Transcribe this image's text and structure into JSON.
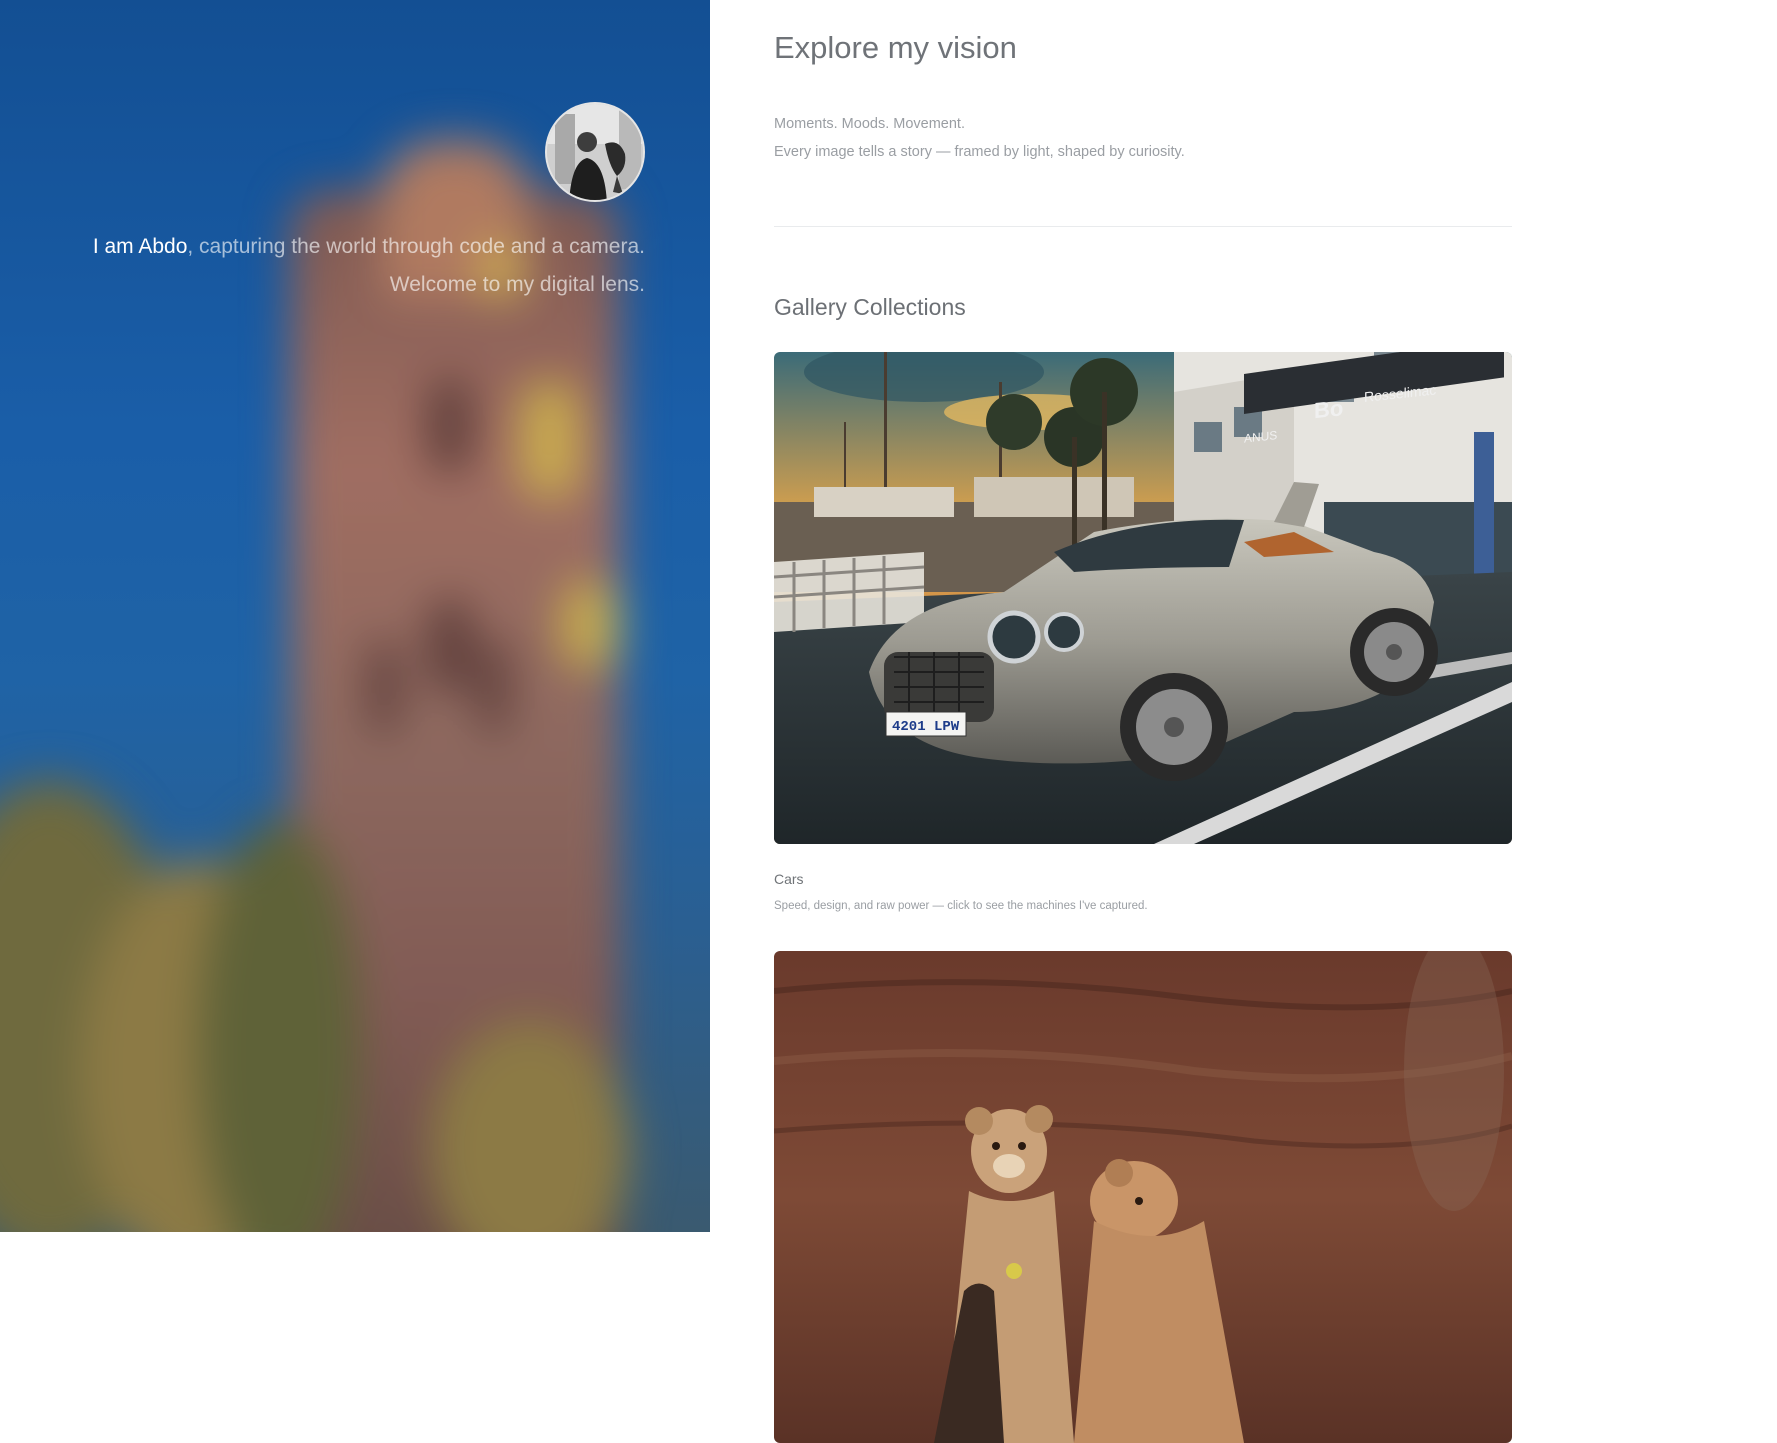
{
  "profile": {
    "name": "I am Abdo",
    "intro_rest": ", capturing the world through code and a camera.",
    "intro_line2": "Welcome to my digital lens."
  },
  "main": {
    "title": "Explore my vision",
    "tagline_1": "Moments. Moods. Movement.",
    "tagline_2": "Every image tells a story — framed by light, shaped by curiosity.",
    "section_title": "Gallery Collections"
  },
  "gallery": [
    {
      "title": "Cars",
      "description": "Speed, design, and raw power — click to see the machines I've captured.",
      "plate": "4201 LPW",
      "signs": [
        "Bo",
        "Rosselimac",
        "ANUS"
      ]
    },
    {
      "title": "",
      "description": ""
    }
  ],
  "colors": {
    "hero_blue": "#1a5ea8",
    "text_muted": "#9a9ea3",
    "heading": "#6f7378"
  }
}
